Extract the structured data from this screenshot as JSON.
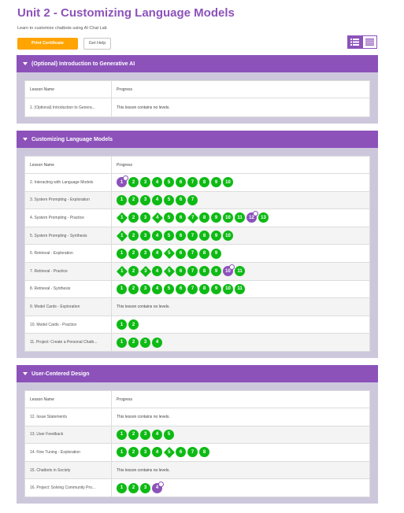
{
  "page": {
    "title": "Unit 2 - Customizing Language Models",
    "subtitle": "Learn to customize chatbots using AI Chat Lab",
    "print_label": "Print Certificate",
    "help_label": "Get Help",
    "colors": {
      "accent": "#8c52ba",
      "orange": "#ffa400",
      "green": "#0eba14",
      "section_bg": "#cdc7dc"
    }
  },
  "table_headers": {
    "name": "Lesson Name",
    "progress": "Progress"
  },
  "no_levels_text": "This lesson contains no levels.",
  "sections": [
    {
      "title": "(Optional) Introduction to Generative AI",
      "lessons": [
        {
          "name": "1. (Optional) Introduction to Genera...",
          "levels": []
        }
      ]
    },
    {
      "title": "Customizing Language Models",
      "lessons": [
        {
          "name": "2. Interacting with Language Models",
          "levels": [
            [
              "1",
              "p"
            ],
            [
              "2",
              "c"
            ],
            [
              "3",
              "c"
            ],
            [
              "4",
              "c"
            ],
            [
              "5",
              "c"
            ],
            [
              "6",
              "c"
            ],
            [
              "7",
              "c"
            ],
            [
              "8",
              "c"
            ],
            [
              "9",
              "c"
            ],
            [
              "10",
              "c"
            ]
          ]
        },
        {
          "name": "3. System Prompting - Exploration",
          "levels": [
            [
              "1",
              "c"
            ],
            [
              "2",
              "c"
            ],
            [
              "3",
              "c"
            ],
            [
              "4",
              "c"
            ],
            [
              "5",
              "c"
            ],
            [
              "6",
              "c"
            ],
            [
              "7",
              "c"
            ]
          ]
        },
        {
          "name": "4. System Prompting - Practice",
          "levels": [
            [
              "1",
              "d"
            ],
            [
              "2",
              "c"
            ],
            [
              "3",
              "c"
            ],
            [
              "4",
              "d"
            ],
            [
              "5",
              "c"
            ],
            [
              "6",
              "c"
            ],
            [
              "7",
              "d"
            ],
            [
              "8",
              "c"
            ],
            [
              "9",
              "c"
            ],
            [
              "10",
              "c"
            ],
            [
              "11",
              "c"
            ],
            [
              "12",
              "p"
            ],
            [
              "13",
              "c"
            ]
          ]
        },
        {
          "name": "5. System Prompting - Synthesis",
          "levels": [
            [
              "1",
              "d"
            ],
            [
              "2",
              "c"
            ],
            [
              "3",
              "c"
            ],
            [
              "4",
              "c"
            ],
            [
              "5",
              "c"
            ],
            [
              "6",
              "c"
            ],
            [
              "7",
              "c"
            ],
            [
              "8",
              "c"
            ],
            [
              "9",
              "c"
            ],
            [
              "10",
              "c"
            ]
          ]
        },
        {
          "name": "6. Retrieval - Exploration",
          "levels": [
            [
              "1",
              "c"
            ],
            [
              "2",
              "c"
            ],
            [
              "3",
              "c"
            ],
            [
              "4",
              "c"
            ],
            [
              "5",
              "d"
            ],
            [
              "6",
              "c"
            ],
            [
              "7",
              "c"
            ],
            [
              "8",
              "c"
            ],
            [
              "9",
              "c"
            ]
          ]
        },
        {
          "name": "7. Retrieval - Practice",
          "levels": [
            [
              "1",
              "d"
            ],
            [
              "2",
              "c"
            ],
            [
              "3",
              "d"
            ],
            [
              "4",
              "c"
            ],
            [
              "5",
              "d"
            ],
            [
              "6",
              "c"
            ],
            [
              "7",
              "c"
            ],
            [
              "8",
              "c"
            ],
            [
              "9",
              "c"
            ],
            [
              "10",
              "p"
            ],
            [
              "11",
              "c"
            ]
          ]
        },
        {
          "name": "8. Retrieval - Synthesis",
          "levels": [
            [
              "1",
              "c"
            ],
            [
              "2",
              "c"
            ],
            [
              "3",
              "c"
            ],
            [
              "4",
              "c"
            ],
            [
              "5",
              "c"
            ],
            [
              "6",
              "c"
            ],
            [
              "7",
              "c"
            ],
            [
              "8",
              "c"
            ],
            [
              "9",
              "c"
            ],
            [
              "10",
              "c"
            ],
            [
              "11",
              "c"
            ]
          ]
        },
        {
          "name": "9. Model Cards - Exploration",
          "levels": []
        },
        {
          "name": "10. Model Cards - Practice",
          "levels": [
            [
              "1",
              "c"
            ],
            [
              "2",
              "c"
            ]
          ]
        },
        {
          "name": "11. Project: Create a Personal Chatb...",
          "levels": [
            [
              "1",
              "c"
            ],
            [
              "2",
              "c"
            ],
            [
              "3",
              "c"
            ],
            [
              "4",
              "c"
            ]
          ]
        }
      ]
    },
    {
      "title": "User-Centered Design",
      "lessons": [
        {
          "name": "12. Issue Statements",
          "levels": []
        },
        {
          "name": "13. User Feedback",
          "levels": [
            [
              "1",
              "c"
            ],
            [
              "2",
              "c"
            ],
            [
              "3",
              "c"
            ],
            [
              "4",
              "c"
            ],
            [
              "5",
              "c"
            ]
          ]
        },
        {
          "name": "14. Fine Tuning - Exploration",
          "levels": [
            [
              "1",
              "c"
            ],
            [
              "2",
              "c"
            ],
            [
              "3",
              "c"
            ],
            [
              "4",
              "c"
            ],
            [
              "5",
              "d"
            ],
            [
              "6",
              "c"
            ],
            [
              "7",
              "c"
            ],
            [
              "8",
              "c"
            ]
          ]
        },
        {
          "name": "15. Chatbots in Society",
          "levels": []
        },
        {
          "name": "16. Project: Solving Community Pro...",
          "levels": [
            [
              "1",
              "c"
            ],
            [
              "2",
              "c"
            ],
            [
              "3",
              "c"
            ],
            [
              "4",
              "p"
            ]
          ]
        }
      ]
    }
  ]
}
